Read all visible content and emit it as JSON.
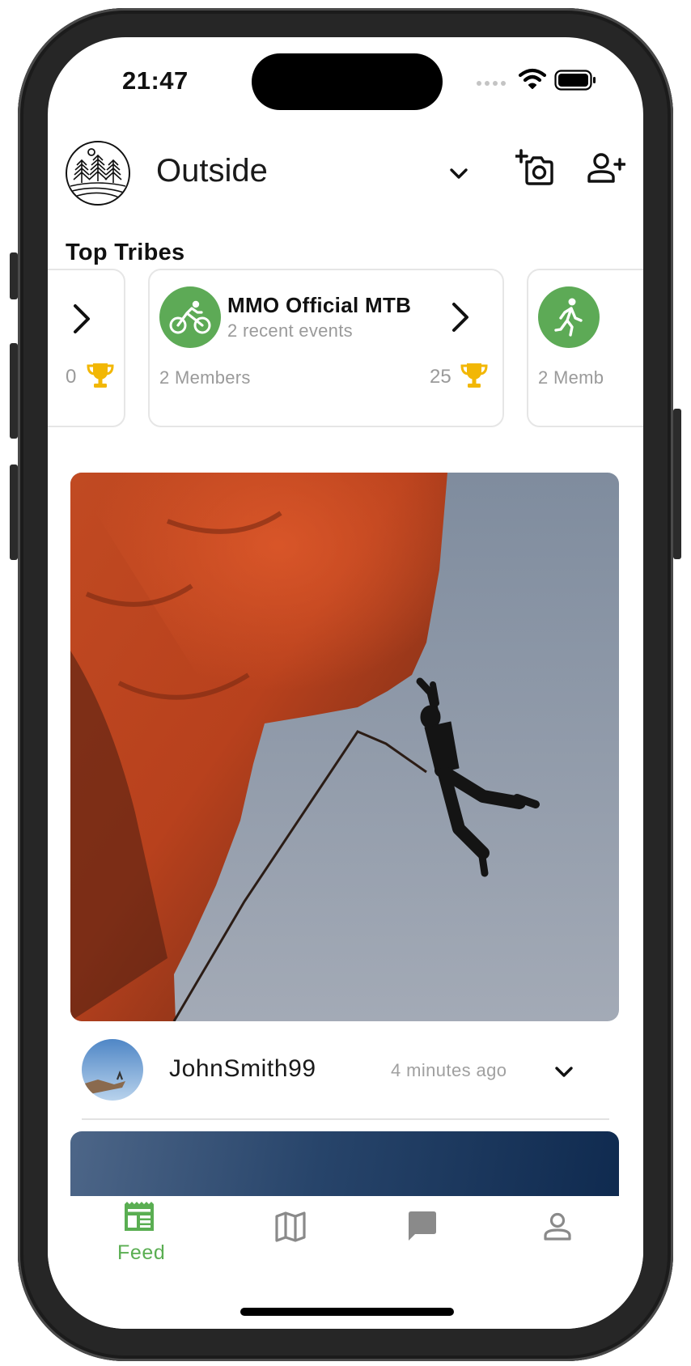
{
  "status_bar": {
    "time": "21:47"
  },
  "header": {
    "community": "Outside"
  },
  "top_tribes": {
    "title": "Top Tribes",
    "cards": [
      {
        "title": "",
        "subtitle": "",
        "members": "",
        "score": "0"
      },
      {
        "title": "MMO Official MTB",
        "subtitle": "2 recent events",
        "members": "2 Members",
        "score": "25"
      },
      {
        "title": "",
        "subtitle": "",
        "members": "2 Memb",
        "score": ""
      }
    ]
  },
  "post": {
    "author": "JohnSmith99",
    "time": "4 minutes ago"
  },
  "tab_bar": {
    "feed_label": "Feed"
  },
  "colors": {
    "accent_green": "#5daa56",
    "trophy_gold": "#f2b705",
    "icon_gray": "#8a8a8a"
  }
}
